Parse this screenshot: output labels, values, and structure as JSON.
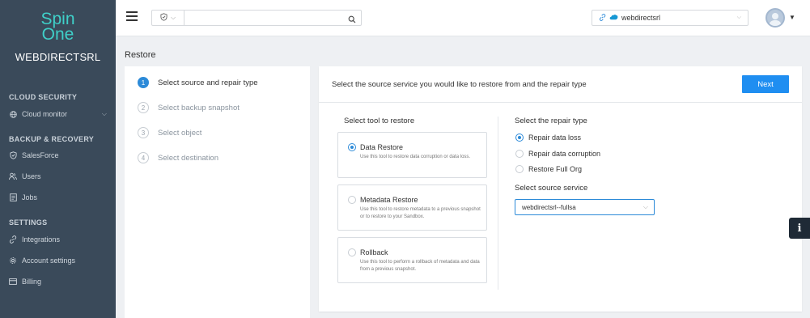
{
  "brand": {
    "logo_line1": "Spin",
    "logo_line2": "One",
    "logo_color": "#3fd0c9",
    "company": "WEBDIRECTSRL"
  },
  "sidebar": {
    "sections": [
      {
        "title": "CLOUD SECURITY",
        "items": [
          {
            "label": "Cloud monitor",
            "icon": "globe-icon",
            "expandable": true
          }
        ]
      },
      {
        "title": "BACKUP & RECOVERY",
        "items": [
          {
            "label": "SalesForce",
            "icon": "shield-check-icon"
          },
          {
            "label": "Users",
            "icon": "users-icon"
          },
          {
            "label": "Jobs",
            "icon": "jobs-icon"
          }
        ]
      },
      {
        "title": "SETTINGS",
        "items": [
          {
            "label": "Integrations",
            "icon": "link-icon"
          },
          {
            "label": "Account settings",
            "icon": "gear-icon"
          },
          {
            "label": "Billing",
            "icon": "card-icon"
          }
        ]
      }
    ]
  },
  "topbar": {
    "search": {
      "value": "",
      "placeholder": ""
    },
    "account": {
      "label": "webdirectsrl",
      "icon": "salesforce-cloud-icon"
    }
  },
  "breadcrumb": "Restore",
  "steps": [
    {
      "number": "1",
      "label": "Select source and repair type",
      "active": true
    },
    {
      "number": "2",
      "label": "Select backup snapshot",
      "active": false
    },
    {
      "number": "3",
      "label": "Select object",
      "active": false
    },
    {
      "number": "4",
      "label": "Select destination",
      "active": false
    }
  ],
  "card": {
    "instruction": "Select the source service you would like to restore from and the repair type",
    "next_label": "Next",
    "tool_title": "Select tool to restore",
    "tools": [
      {
        "title": "Data Restore",
        "desc": "Use this tool to restore data corruption or data loss.",
        "selected": true
      },
      {
        "title": "Metadata Restore",
        "desc": "Use this tool to restore metadata to a previous snapshot or to restore to your Sandbox.",
        "selected": false
      },
      {
        "title": "Rollback",
        "desc": "Use this tool to perform a rollback of metadata and data from a previous snapshot.",
        "selected": false
      }
    ],
    "repair_title": "Select the repair type",
    "repair_options": [
      {
        "label": "Repair data loss",
        "selected": true
      },
      {
        "label": "Repair data corruption",
        "selected": false
      },
      {
        "label": "Restore Full Org",
        "selected": false
      }
    ],
    "source_title": "Select source service",
    "source_value": "webdirectsrl--fullsa"
  },
  "info_button": "i",
  "colors": {
    "accent": "#2c8ad8",
    "sidebar_bg": "#3a4a5a",
    "next_bg": "#1f8ef1"
  }
}
